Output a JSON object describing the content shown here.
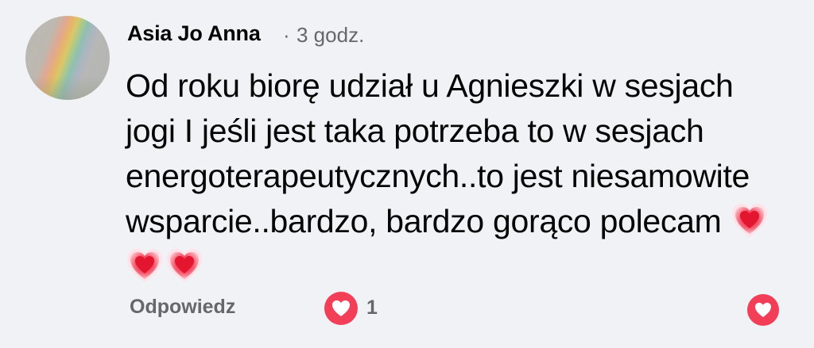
{
  "comment": {
    "author": "Asia Jo Anna",
    "separator": "·",
    "time": "3 godz.",
    "text": "Od roku biorę udział u Agnieszki w sesjach jogi I jeśli jest taka potrzeba to w sesjach energoterapeutycznych..to jest niesamowite wsparcie..bardzo, bardzo gorąco polecam",
    "emojis": [
      "sparkling-heart",
      "sparkling-heart",
      "sparkling-heart"
    ]
  },
  "actions": {
    "reply_label": "Odpowiedz",
    "reaction_icon": "heart-icon",
    "reaction_count": "1",
    "like_icon": "heart-icon"
  },
  "colors": {
    "background": "#f0f2f5",
    "text": "#050505",
    "secondary_text": "#65676b",
    "love_red": "#f33e58"
  }
}
